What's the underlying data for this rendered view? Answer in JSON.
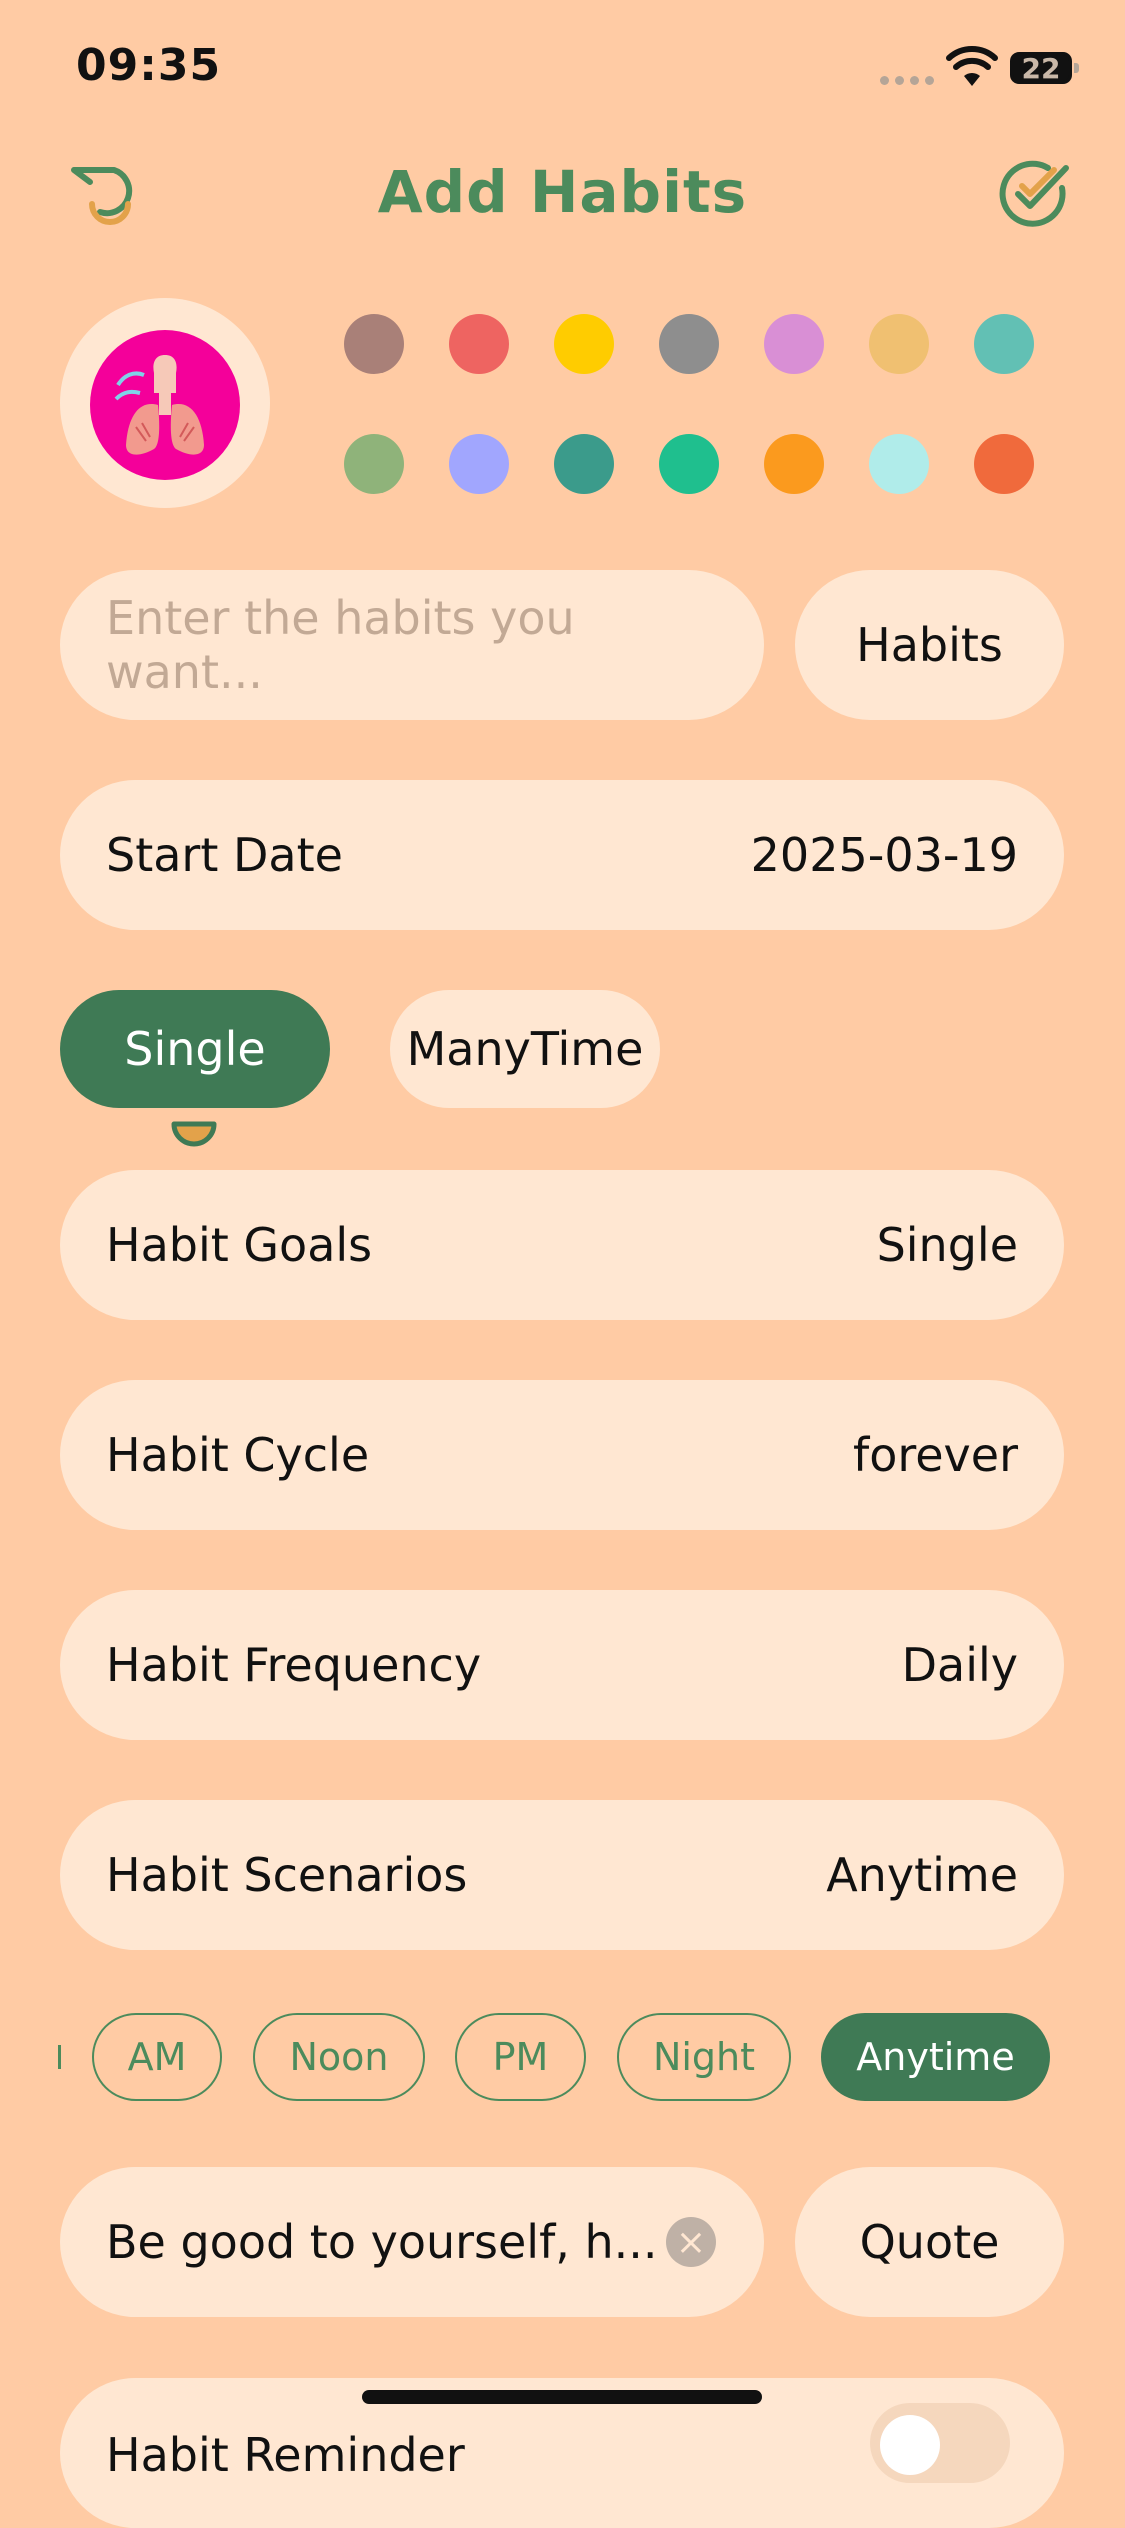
{
  "status_bar": {
    "time": "09:35",
    "battery": "22"
  },
  "nav": {
    "title": "Add Habits"
  },
  "colors": [
    "#A98078",
    "#EE6461",
    "#FFCC00",
    "#8E8E8E",
    "#D98FD5",
    "#F0C071",
    "#62C0B4",
    "#8FB37A",
    "#A1A6FE",
    "#3B9B8B",
    "#1FBF8E",
    "#FB9A1E",
    "#B0ECEA",
    "#F06A3C"
  ],
  "search": {
    "placeholder": "Enter the habits you want..."
  },
  "habits_button": "Habits",
  "start_date": {
    "label": "Start Date",
    "value": "2025-03-19"
  },
  "segments": {
    "single": "Single",
    "many": "ManyTime"
  },
  "rows": {
    "goals": {
      "label": "Habit Goals",
      "value": "Single"
    },
    "cycle": {
      "label": "Habit Cycle",
      "value": "forever"
    },
    "frequency": {
      "label": "Habit Frequency",
      "value": "Daily"
    },
    "scenarios": {
      "label": "Habit Scenarios",
      "value": "Anytime"
    }
  },
  "scenario_chips": [
    "AM",
    "Noon",
    "PM",
    "Night",
    "Anytime"
  ],
  "selected_scenario": "Anytime",
  "quote": {
    "value": "Be good to yourself, h...",
    "button": "Quote"
  },
  "reminder": {
    "label": "Habit Reminder"
  },
  "accent": "#3F7A55",
  "background": "#FFCBA4"
}
